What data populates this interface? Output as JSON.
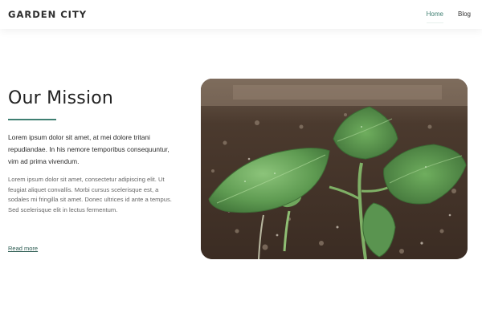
{
  "header": {
    "brand": "GARDEN CITY",
    "nav": [
      {
        "label": "Home",
        "active": true
      },
      {
        "label": "Blog",
        "active": false
      }
    ]
  },
  "mission": {
    "title": "Our Mission",
    "lead": "Lorem ipsum dolor sit amet, at mei dolore tritani repudiandae. In his nemore temporibus consequuntur, vim ad prima vivendum.",
    "body": "Lorem ipsum dolor sit amet, consectetur adipiscing elit. Ut feugiat aliquet convallis. Morbi cursus scelerisque est, a sodales mi fringilla sit amet. Donec ultrices id ante a tempus. Sed scelerisque elit in lectus fermentum.",
    "read_more": "Read more"
  },
  "image": {
    "subject": "seedling in soil"
  },
  "colors": {
    "accent": "#3f7f72",
    "text": "#2b2b2b",
    "muted": "#666666"
  }
}
